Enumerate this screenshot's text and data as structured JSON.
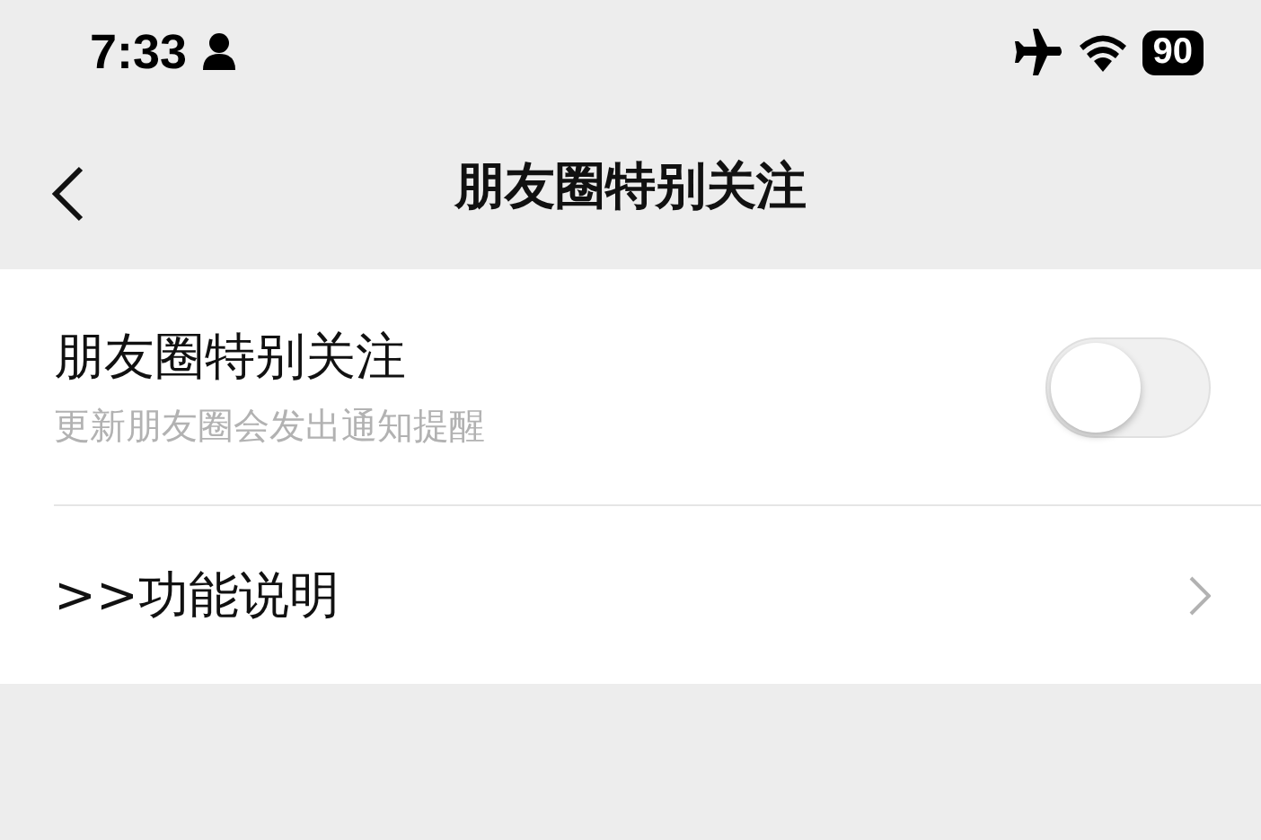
{
  "status_bar": {
    "time": "7:33",
    "battery": "90"
  },
  "nav": {
    "title": "朋友圈特别关注"
  },
  "settings": [
    {
      "kind": "toggle",
      "label": "朋友圈特别关注",
      "description": "更新朋友圈会发出通知提醒",
      "on": false
    },
    {
      "kind": "link",
      "label": ">>功能说明"
    }
  ]
}
